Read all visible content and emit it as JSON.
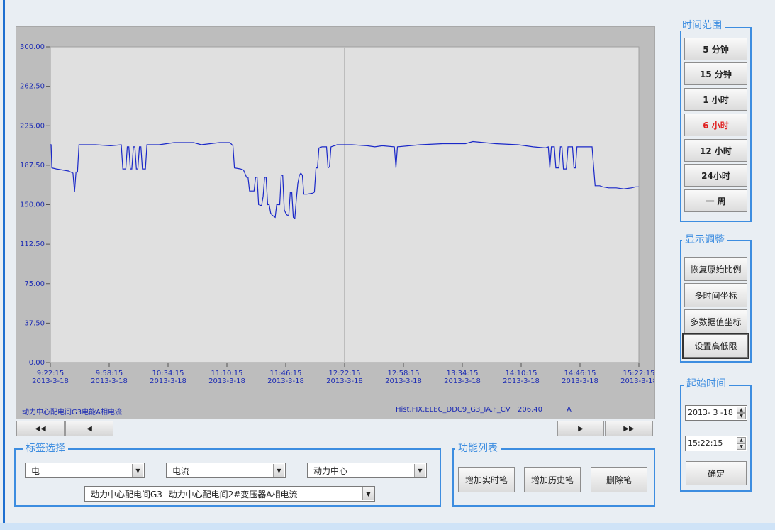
{
  "chart_data": {
    "type": "line",
    "ylim": [
      0,
      300
    ],
    "yticks": [
      "300.00",
      "262.50",
      "225.00",
      "187.50",
      "150.00",
      "112.50",
      "75.00",
      "37.50",
      "0.00"
    ],
    "xticks": [
      {
        "time": "9:22:15",
        "date": "2013-3-18"
      },
      {
        "time": "9:58:15",
        "date": "2013-3-18"
      },
      {
        "time": "10:34:15",
        "date": "2013-3-18"
      },
      {
        "time": "11:10:15",
        "date": "2013-3-18"
      },
      {
        "time": "11:46:15",
        "date": "2013-3-18"
      },
      {
        "time": "12:22:15",
        "date": "2013-3-18"
      },
      {
        "time": "12:58:15",
        "date": "2013-3-18"
      },
      {
        "time": "13:34:15",
        "date": "2013-3-18"
      },
      {
        "time": "14:10:15",
        "date": "2013-3-18"
      },
      {
        "time": "14:46:15",
        "date": "2013-3-18"
      },
      {
        "time": "15:22:15",
        "date": "2013-3-18"
      }
    ],
    "series": [
      {
        "color": "#1a28c8",
        "points": [
          [
            0,
            207
          ],
          [
            0.5,
            207
          ],
          [
            1,
            185
          ],
          [
            4,
            184
          ],
          [
            12,
            182
          ],
          [
            15,
            180
          ],
          [
            16,
            162
          ],
          [
            17,
            181
          ],
          [
            18,
            181
          ],
          [
            19,
            207
          ],
          [
            30,
            207
          ],
          [
            40,
            206
          ],
          [
            47,
            207
          ],
          [
            48,
            184
          ],
          [
            50,
            184
          ],
          [
            51,
            205
          ],
          [
            52,
            205
          ],
          [
            53,
            184
          ],
          [
            54,
            184
          ],
          [
            55,
            205
          ],
          [
            56,
            205
          ],
          [
            57,
            184
          ],
          [
            58,
            184
          ],
          [
            59,
            205
          ],
          [
            60,
            205
          ],
          [
            61,
            184
          ],
          [
            63,
            184
          ],
          [
            64,
            207
          ],
          [
            72,
            207
          ],
          [
            82,
            209
          ],
          [
            95,
            209
          ],
          [
            100,
            207
          ],
          [
            112,
            209
          ],
          [
            119,
            209
          ],
          [
            121,
            206
          ],
          [
            122,
            185
          ],
          [
            126,
            184
          ],
          [
            128,
            183
          ],
          [
            130,
            176
          ],
          [
            131,
            176
          ],
          [
            132,
            163
          ],
          [
            135,
            163
          ],
          [
            136,
            176
          ],
          [
            137,
            176
          ],
          [
            138,
            150
          ],
          [
            140,
            149
          ],
          [
            141,
            158
          ],
          [
            142,
            176
          ],
          [
            143,
            176
          ],
          [
            144,
            150
          ],
          [
            145,
            150
          ],
          [
            146,
            142
          ],
          [
            147,
            140
          ],
          [
            149,
            138
          ],
          [
            150,
            150
          ],
          [
            152,
            150
          ],
          [
            153,
            178
          ],
          [
            154,
            178
          ],
          [
            155,
            145
          ],
          [
            156,
            142
          ],
          [
            157,
            140
          ],
          [
            158,
            140
          ],
          [
            159,
            162
          ],
          [
            160,
            162
          ],
          [
            161,
            138
          ],
          [
            162,
            137
          ],
          [
            163,
            155
          ],
          [
            164,
            170
          ],
          [
            165,
            178
          ],
          [
            166,
            180
          ],
          [
            167,
            178
          ],
          [
            168,
            160
          ],
          [
            170,
            160
          ],
          [
            174,
            161
          ],
          [
            175,
            162
          ],
          [
            176,
            185
          ],
          [
            177,
            185
          ],
          [
            178,
            204
          ],
          [
            180,
            205
          ],
          [
            183,
            205
          ],
          [
            184,
            185
          ],
          [
            185,
            186
          ],
          [
            186,
            205
          ],
          [
            190,
            207
          ],
          [
            200,
            207
          ],
          [
            210,
            206
          ],
          [
            215,
            205
          ],
          [
            220,
            206
          ],
          [
            228,
            205
          ],
          [
            229,
            185
          ],
          [
            230,
            205
          ],
          [
            245,
            207
          ],
          [
            260,
            208
          ],
          [
            275,
            208
          ],
          [
            280,
            210
          ],
          [
            295,
            208
          ],
          [
            310,
            207
          ],
          [
            320,
            205
          ],
          [
            328,
            204
          ],
          [
            330,
            205
          ],
          [
            331,
            185
          ],
          [
            332,
            205
          ],
          [
            334,
            205
          ],
          [
            335,
            185
          ],
          [
            337,
            185
          ],
          [
            338,
            205
          ],
          [
            339,
            205
          ],
          [
            340,
            184
          ],
          [
            342,
            184
          ],
          [
            343,
            205
          ],
          [
            345,
            205
          ],
          [
            346,
            205
          ],
          [
            347,
            185
          ],
          [
            348,
            185
          ],
          [
            349,
            205
          ],
          [
            355,
            205
          ],
          [
            359,
            205
          ],
          [
            360,
            186
          ],
          [
            361,
            168
          ],
          [
            364,
            168
          ],
          [
            366,
            167
          ],
          [
            370,
            166
          ],
          [
            375,
            166
          ],
          [
            380,
            165
          ],
          [
            385,
            166
          ],
          [
            388,
            167
          ],
          [
            390,
            167
          ]
        ]
      }
    ]
  },
  "chart_caption": {
    "left_label": "动力中心配电间G3电能A相电流",
    "tag": "Hist.FIX.ELEC_DDC9_G3_IA.F_CV",
    "value": "206.40",
    "unit": "A"
  },
  "nav": {
    "first": "◀◀",
    "prev": "◀",
    "next": "▶",
    "last": "▶▶"
  },
  "time_range": {
    "title": "时间范围",
    "buttons": [
      "5 分钟",
      "15 分钟",
      "1 小时",
      "6 小时",
      "12 小时",
      "24小时",
      "一 周"
    ],
    "active_index": 3,
    "active_color": "#e02020"
  },
  "display_adjust": {
    "title": "显示调整",
    "buttons": [
      "恢复原始比例",
      "多时间坐标",
      "多数据值坐标",
      "设置高低限"
    ]
  },
  "start_time": {
    "title": "起始时间",
    "date": "2013- 3 -18",
    "time": "15:22:15",
    "confirm": "确定"
  },
  "tag_select": {
    "title": "标签选择",
    "select1": "电",
    "select2": "电流",
    "select3": "动力中心",
    "select4": "动力中心配电间G3--动力中心配电间2#变压器A相电流"
  },
  "function_list": {
    "title": "功能列表",
    "add_realtime": "增加实时笔",
    "add_history": "增加历史笔",
    "delete": "删除笔"
  },
  "accent_color": "#3d8de0"
}
